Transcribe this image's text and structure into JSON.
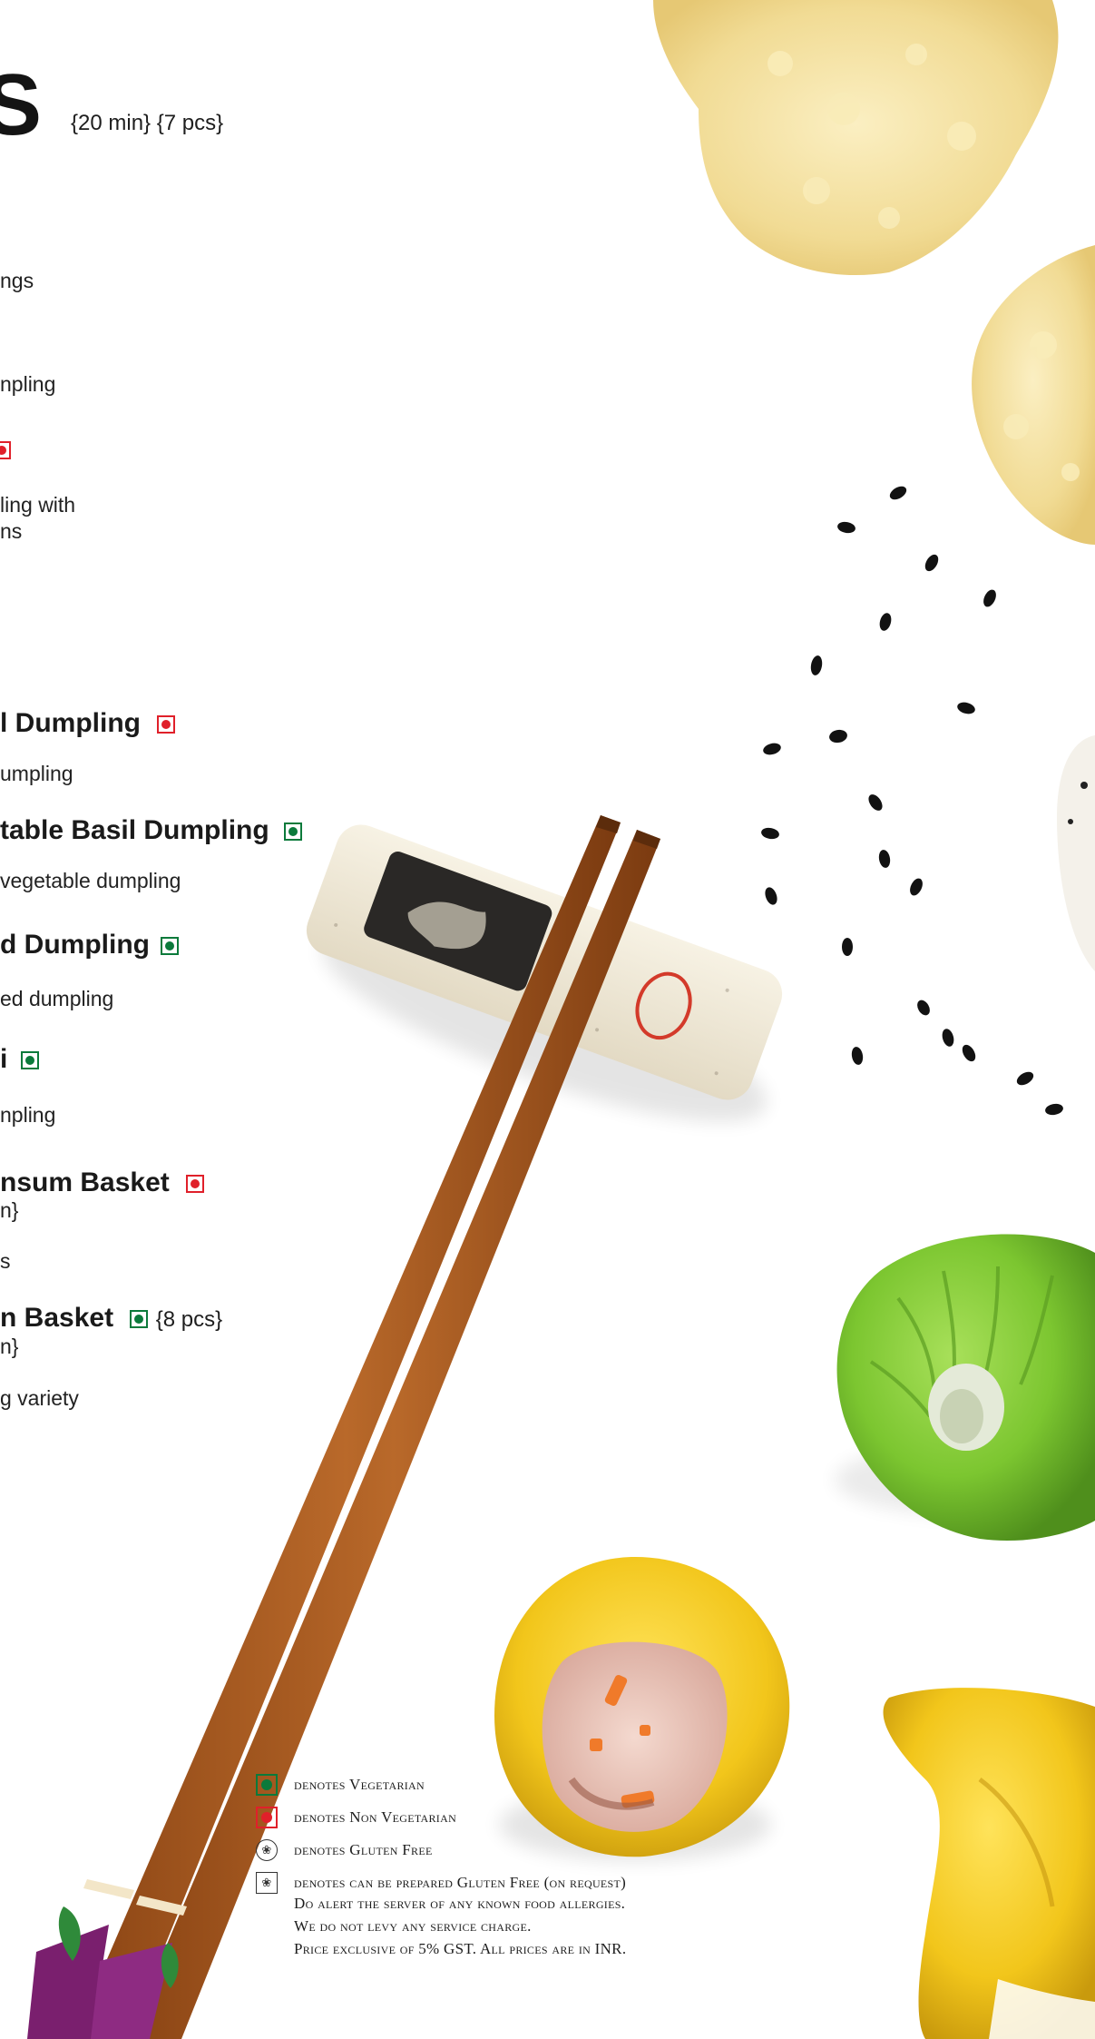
{
  "heading": {
    "visible_letter": "S",
    "meta": "{20 min} {7 pcs}"
  },
  "items": [
    {
      "desc": "ngs"
    },
    {
      "desc": "npling"
    },
    {
      "desc_line1": "ling with",
      "desc_line2": "ns"
    },
    {
      "name": "l Dumpling",
      "desc": "umpling"
    },
    {
      "name": "table Basil Dumpling",
      "desc": "vegetable dumpling"
    },
    {
      "name": "d Dumpling",
      "desc": "ed dumpling"
    },
    {
      "name": "i",
      "desc": "npling"
    },
    {
      "name": "nsum Basket",
      "desc_line1": "n}",
      "desc_line2": "s"
    },
    {
      "name": "n Basket",
      "inline_meta": "{8 pcs}",
      "desc_line1": "n}",
      "desc_line2": "g variety"
    }
  ],
  "legend": {
    "vegetarian": "denotes Vegetarian",
    "non_vegetarian": "denotes Non Vegetarian",
    "gluten_free": "denotes Gluten Free",
    "gluten_free_request": "denotes can be prepared Gluten Free (on request)",
    "allergy_note": "Do alert the server of any known food allergies.",
    "service_note": "We do not levy any service charge.",
    "price_note": "Price exclusive of 5% GST. All prices are in INR."
  },
  "colors": {
    "veg": "#0b7a3b",
    "non_veg": "#e0202a",
    "chopstick": "#a8561e",
    "wrapper_green": "#7dc72f",
    "wrapper_yellow": "#f0c21a"
  },
  "icons": [
    "veg-mark-icon",
    "non-veg-mark-icon",
    "gluten-free-icon",
    "gluten-free-on-request-icon"
  ]
}
